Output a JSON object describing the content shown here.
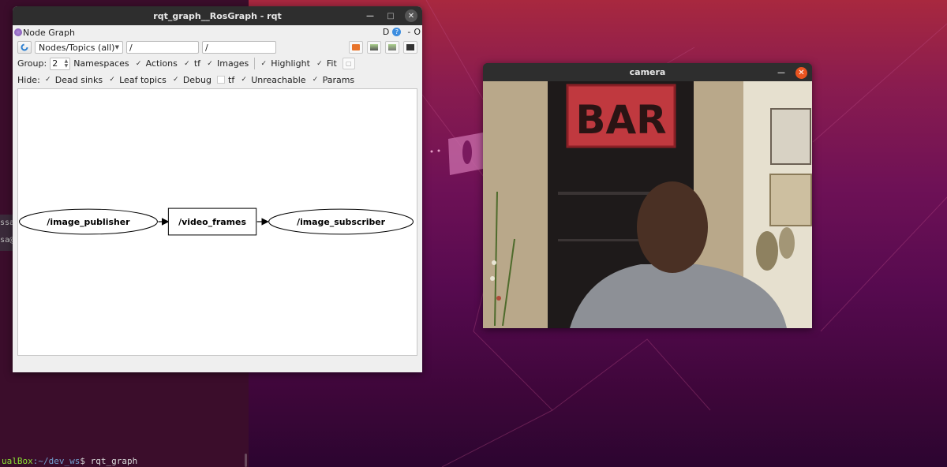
{
  "desktop": {
    "colors": {
      "wallpaper_top": "#a8283f",
      "wallpaper_bottom": "#2c0530",
      "accent_orange": "#e95420"
    }
  },
  "terminal": {
    "prompt_host_fragment": "ualBox",
    "prompt_path": ":~/dev_ws",
    "prompt_symbol": "$",
    "command": "rqt_graph",
    "cut_text_lines": [
      "ssa",
      "sa@"
    ]
  },
  "rqt_window": {
    "title": "rqt_graph__RosGraph - rqt",
    "plugin_title": "Node Graph",
    "plugin_right_label": "D",
    "plugin_help": "?",
    "plugin_dash": "-",
    "plugin_o": "O",
    "toolbar": {
      "refresh_icon": "refresh-icon",
      "filter_select": "Nodes/Topics (all)",
      "topic_filter_1": "/",
      "topic_filter_2": "/",
      "tools": [
        "open-icon",
        "save-dot-icon",
        "save-image-icon",
        "screenshot-icon"
      ]
    },
    "options": {
      "group_label": "Group:",
      "group_value": "2",
      "items": [
        {
          "label": "Namespaces",
          "checked": null
        },
        {
          "label": "Actions",
          "checked": true
        },
        {
          "label": "tf",
          "checked": true
        },
        {
          "label": "Images",
          "checked": true
        },
        {
          "label": "Highlight",
          "checked": true
        },
        {
          "label": "Fit",
          "checked": true
        }
      ]
    },
    "hide": {
      "label": "Hide:",
      "items": [
        {
          "label": "Dead sinks",
          "checked": true
        },
        {
          "label": "Leaf topics",
          "checked": true
        },
        {
          "label": "Debug",
          "checked": true
        },
        {
          "label": "tf",
          "checked": false
        },
        {
          "label": "Unreachable",
          "checked": true
        },
        {
          "label": "Params",
          "checked": true
        }
      ]
    },
    "graph": {
      "nodes": [
        {
          "id": "/image_publisher",
          "shape": "ellipse"
        },
        {
          "id": "/video_frames",
          "shape": "box"
        },
        {
          "id": "/image_subscriber",
          "shape": "ellipse"
        }
      ],
      "edges": [
        {
          "from": "/image_publisher",
          "to": "/video_frames"
        },
        {
          "from": "/video_frames",
          "to": "/image_subscriber"
        }
      ]
    }
  },
  "camera_window": {
    "title": "camera",
    "feed_description": "live webcam frame",
    "visible_sign_text": "BAR"
  }
}
